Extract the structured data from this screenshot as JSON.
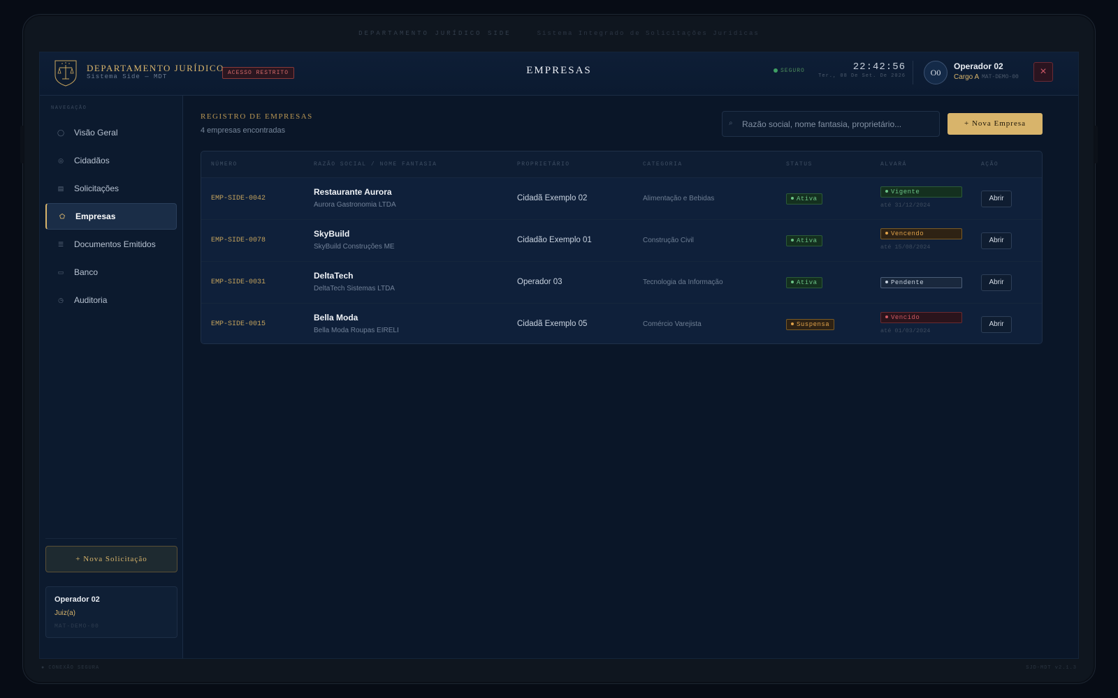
{
  "bezel": {
    "top_title": "DEPARTAMENTO JURÍDICO SIDE",
    "top_subtitle": "Sistema Integrado de Solicitações Jurídicas",
    "bottom_left": "● CONEXÃO SEGURA",
    "bottom_right": "SJD-MDT v2.1.3"
  },
  "header": {
    "dept_title": "DEPARTAMENTO JURÍDICO",
    "dept_subtitle": "Sistema Side — MDT",
    "restricted_badge": "ACESSO RESTRITO",
    "page_title": "EMPRESAS",
    "secure_label": "SEGURO",
    "clock": "22:42:56",
    "date": "Ter., 08 De Set. De 2026",
    "user": {
      "initials": "O0",
      "name": "Operador 02",
      "cargo": "Cargo A",
      "matricula": "MAT-DEMO-00"
    },
    "close_icon": "×"
  },
  "sidebar": {
    "heading": "NAVEGAÇÃO",
    "items": [
      {
        "label": "Visão Geral",
        "icon": "◯"
      },
      {
        "label": "Cidadãos",
        "icon": "◎"
      },
      {
        "label": "Solicitações",
        "icon": "▤"
      },
      {
        "label": "Empresas",
        "icon": "⬠"
      },
      {
        "label": "Documentos Emitidos",
        "icon": "☰"
      },
      {
        "label": "Banco",
        "icon": "▭"
      },
      {
        "label": "Auditoria",
        "icon": "◷"
      }
    ],
    "active_index": 3,
    "new_request_button": "+ Nova Solicitação",
    "user_card": {
      "name": "Operador 02",
      "role": "Juiz(a)",
      "matricula": "MAT-DEMO-00"
    }
  },
  "main": {
    "section_title": "REGISTRO DE EMPRESAS",
    "count_text": "4 empresas encontradas",
    "search_placeholder": "Razão social, nome fantasia, proprietário...",
    "search_icon": "⌕",
    "new_company_button": "+ Nova Empresa",
    "columns": [
      "NÚMERO",
      "RAZÃO SOCIAL / NOME FANTASIA",
      "PROPRIETÁRIO",
      "CATEGORIA",
      "STATUS",
      "ALVARÁ",
      "AÇÃO"
    ],
    "rows": [
      {
        "numero": "EMP-SIDE-0042",
        "nome": "Restaurante Aurora",
        "razao": "Aurora Gastronomia LTDA",
        "proprietario": "Cidadã Exemplo 02",
        "categoria": "Alimentação e Bebidas",
        "status": "Ativa",
        "alvara": "Vigente",
        "alvara_data": "até 31/12/2024",
        "acao": "Abrir"
      },
      {
        "numero": "EMP-SIDE-0078",
        "nome": "SkyBuild",
        "razao": "SkyBuild Construções ME",
        "proprietario": "Cidadão Exemplo 01",
        "categoria": "Construção Civil",
        "status": "Ativa",
        "alvara": "Vencendo",
        "alvara_data": "até 15/08/2024",
        "acao": "Abrir"
      },
      {
        "numero": "EMP-SIDE-0031",
        "nome": "DeltaTech",
        "razao": "DeltaTech Sistemas LTDA",
        "proprietario": "Operador 03",
        "categoria": "Tecnologia da Informação",
        "status": "Ativa",
        "alvara": "Pendente",
        "alvara_data": "",
        "acao": "Abrir"
      },
      {
        "numero": "EMP-SIDE-0015",
        "nome": "Bella Moda",
        "razao": "Bella Moda Roupas EIRELI",
        "proprietario": "Cidadã Exemplo 05",
        "categoria": "Comércio Varejista",
        "status": "Suspensa",
        "alvara": "Vencido",
        "alvara_data": "até 01/03/2024",
        "acao": "Abrir"
      }
    ]
  },
  "colors": {
    "gold": "#d8b46b",
    "ativa": "#6cc487",
    "vencendo": "#e0a24a",
    "pendente": "#c8d2df",
    "vencido": "#d05a64",
    "background": "#0a1628"
  }
}
